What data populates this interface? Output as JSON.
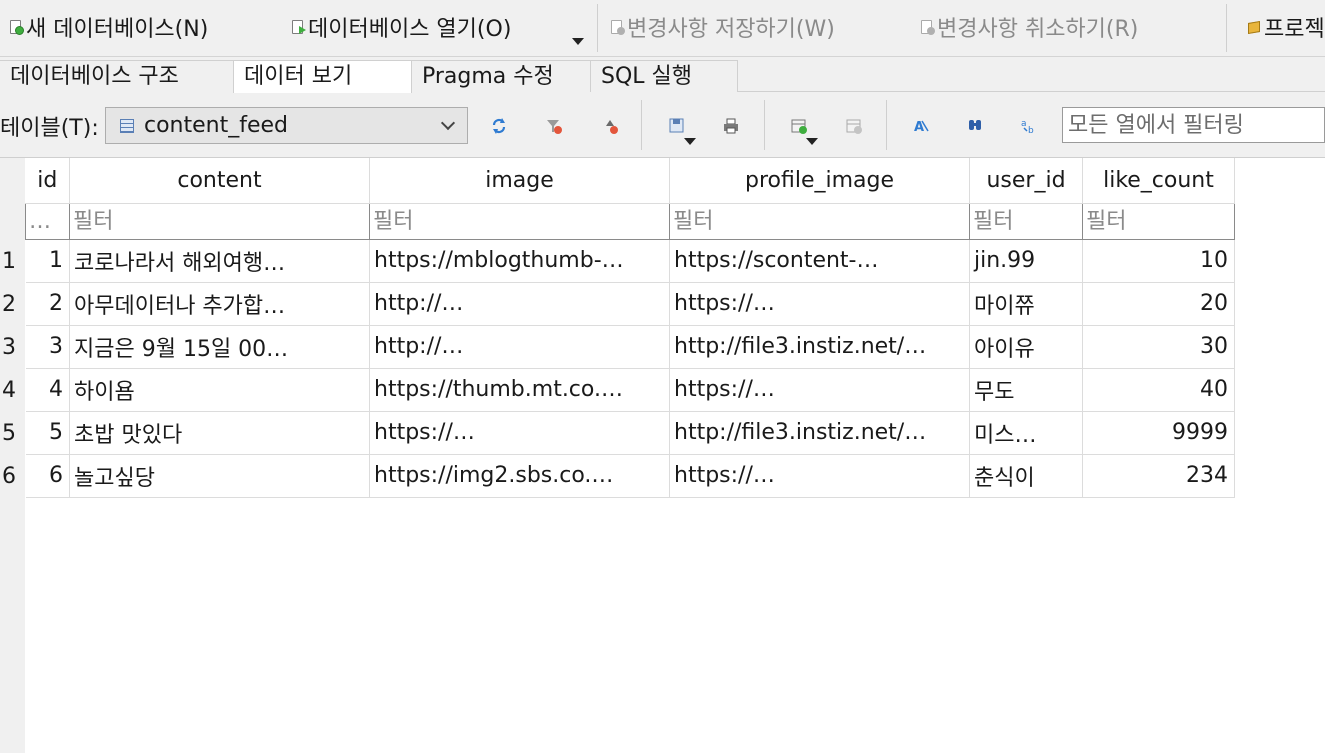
{
  "toolbar": {
    "new_db": "새 데이터베이스(N)",
    "open_db": "데이터베이스 열기(O)",
    "write_changes": "변경사항 저장하기(W)",
    "revert_changes": "변경사항 취소하기(R)",
    "project": "프로젝"
  },
  "tabs": [
    {
      "label": "데이터베이스 구조"
    },
    {
      "label": "데이터 보기"
    },
    {
      "label": "Pragma 수정"
    },
    {
      "label": "SQL 실행"
    }
  ],
  "browse": {
    "table_label": "테이블(T):",
    "table_name": "content_feed",
    "filter_all_placeholder": "모든 열에서 필터링",
    "filter_cell_placeholder": "필터",
    "rowid_filter": "…"
  },
  "columns": [
    "id",
    "content",
    "image",
    "profile_image",
    "user_id",
    "like_count"
  ],
  "rows": [
    {
      "n": "1",
      "id": "1",
      "content": "코로나라서 해외여행…",
      "image": "https://mblogthumb-…",
      "profile_image": "https://scontent-…",
      "user_id": "jin.99",
      "like_count": "10"
    },
    {
      "n": "2",
      "id": "2",
      "content": "아무데이터나 추가합…",
      "image": "http://…",
      "profile_image": "https://…",
      "user_id": "마이쮸",
      "like_count": "20"
    },
    {
      "n": "3",
      "id": "3",
      "content": "지금은 9월 15일 00…",
      "image": "http://…",
      "profile_image": "http://file3.instiz.net/…",
      "user_id": "아이유",
      "like_count": "30"
    },
    {
      "n": "4",
      "id": "4",
      "content": "하이욤",
      "image": "https://thumb.mt.co.…",
      "profile_image": "https://…",
      "user_id": "무도",
      "like_count": "40"
    },
    {
      "n": "5",
      "id": "5",
      "content": "초밥 맛있다",
      "image": "https://…",
      "profile_image": "http://file3.instiz.net/…",
      "user_id": "미스…",
      "like_count": "9999"
    },
    {
      "n": "6",
      "id": "6",
      "content": "놀고싶당",
      "image": "https://img2.sbs.co.…",
      "profile_image": "https://…",
      "user_id": "춘식이",
      "like_count": "234"
    }
  ]
}
